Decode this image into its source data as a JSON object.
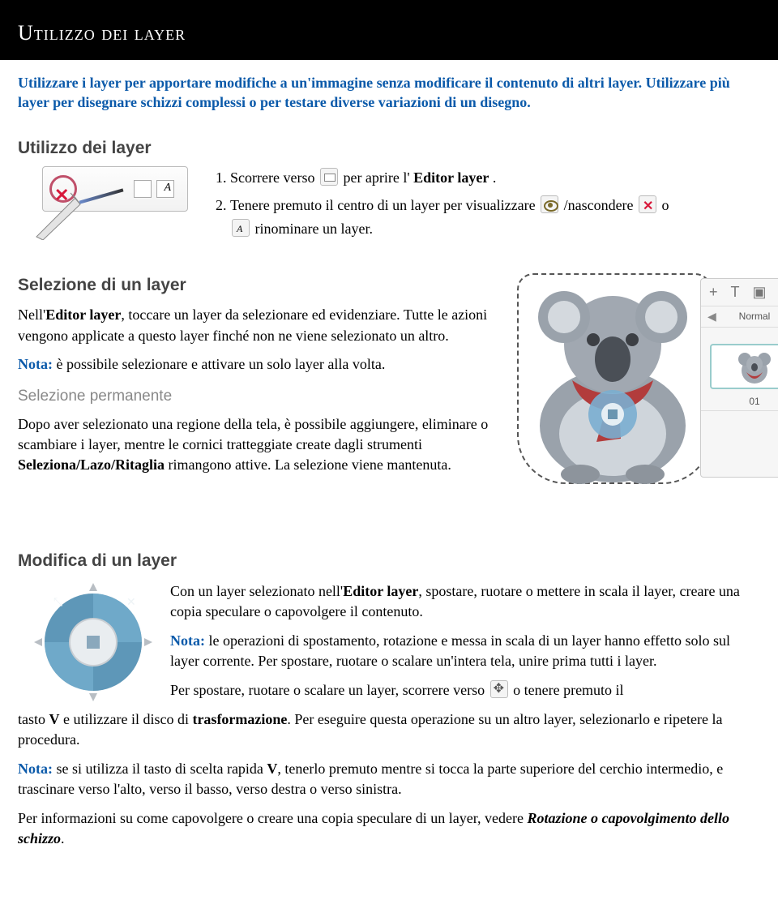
{
  "header": {
    "title": "Utilizzo dei layer",
    "intro": "Utilizzare i layer per apportare modifiche a un'immagine senza modificare il contenuto di altri layer. Utilizzare più layer per disegnare schizzi complessi o per testare diverse variazioni di un disegno."
  },
  "usage": {
    "heading": "Utilizzo dei layer",
    "step1_a": "Scorrere verso ",
    "step1_b": " per aprire l'",
    "step1_c": "Editor layer",
    "step1_d": ".",
    "step2_a": "Tenere premuto il centro di un layer per visualizzare ",
    "step2_b": "/nascondere ",
    "step2_c": " o",
    "step2_d": " rinominare un layer."
  },
  "selection": {
    "heading": "Selezione di un layer",
    "p1_a": "Nell'",
    "p1_b": "Editor layer",
    "p1_c": ", toccare un layer da selezionare ed evidenziare. Tutte le azioni vengono applicate a questo layer finché non ne viene selezionato un altro.",
    "note_label": "Nota:",
    "note_text": " è possibile selezionare e attivare un solo layer alla volta.",
    "sub_heading": "Selezione permanente",
    "p2_a": "Dopo aver selezionato una regione della tela, è possibile aggiungere, eliminare o scambiare i layer, mentre le cornici tratteggiate create dagli strumenti ",
    "p2_b": "Seleziona/Lazo/Ritaglia",
    "p2_c": " rimangono attive. La selezione viene mantenuta."
  },
  "panel": {
    "normal": "Normal",
    "thumb_label": "01"
  },
  "modify": {
    "heading": "Modifica di un layer",
    "p1_a": "Con un layer selezionato nell'",
    "p1_b": "Editor layer",
    "p1_c": ", spostare, ruotare o mettere in scala il layer, creare una copia speculare o capovolgere il contenuto.",
    "note1_label": "Nota:",
    "note1_text": " le operazioni di spostamento, rotazione e messa in scala di un layer hanno effetto solo sul layer corrente. Per spostare, ruotare o scalare un'intera tela, unire prima tutti i layer.",
    "p2_a": "Per spostare, ruotare o scalare un layer, scorrere verso ",
    "p2_b": " o tenere premuto il",
    "p3_a": "tasto ",
    "p3_b": "V",
    "p3_c": " e utilizzare il disco di ",
    "p3_d": "trasformazione",
    "p3_e": ". Per eseguire questa operazione su un altro layer, selezionarlo e ripetere la procedura.",
    "note2_label": "Nota:",
    "note2_text_a": " se si utilizza il tasto di scelta rapida ",
    "note2_text_b": "V",
    "note2_text_c": ", tenerlo premuto mentre si tocca la parte superiore del cerchio intermedio, e trascinare verso l'alto, verso il basso, verso destra o verso sinistra.",
    "p4_a": "Per informazioni su come capovolgere o creare una copia speculare di un layer, vedere ",
    "p4_b": "Rotazione o capovolgimento dello schizzo",
    "p4_c": "."
  }
}
